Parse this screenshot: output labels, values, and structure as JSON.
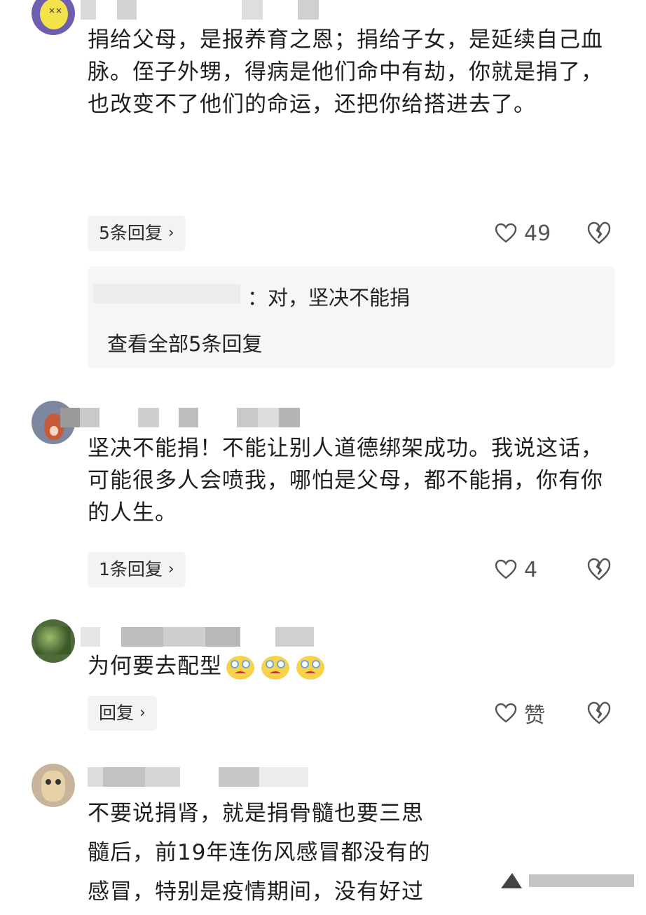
{
  "comments": [
    {
      "text": "捐给父母，是报养育之恩；捐给子女，是延续自己血脉。侄子外甥，得病是他们命中有劫，你就是捐了，也改变不了他们的命运，还把你给搭进去了。",
      "reply_label": "5条回复",
      "likes": "49",
      "sub_reply": {
        "text": "：对，坚决不能捐",
        "view_all": "查看全部5条回复"
      }
    },
    {
      "text": "坚决不能捐！不能让别人道德绑架成功。我说这话，可能很多人会喷我，哪怕是父母，都不能捐，你有你的人生。",
      "reply_label": "1条回复",
      "likes": "4"
    },
    {
      "text": "为何要去配型",
      "emoji": "crying-face-emoji",
      "reply_label": "回复",
      "likes": "赞"
    },
    {
      "text_lines": [
        "不要说捐肾，就是捐骨髓也要三思",
        "髓后，前19年连伤风感冒都没有的",
        "感冒，特别是疫情期间，没有好过"
      ]
    }
  ],
  "icons": {
    "like": "heart-outline-icon",
    "dislike": "broken-heart-icon",
    "chevron": "chevron-right-icon"
  },
  "colors": {
    "pill_bg": "#f3f3f3",
    "subreply_bg": "#f6f6f6",
    "text": "#1e1e1e",
    "icon": "#555555"
  }
}
